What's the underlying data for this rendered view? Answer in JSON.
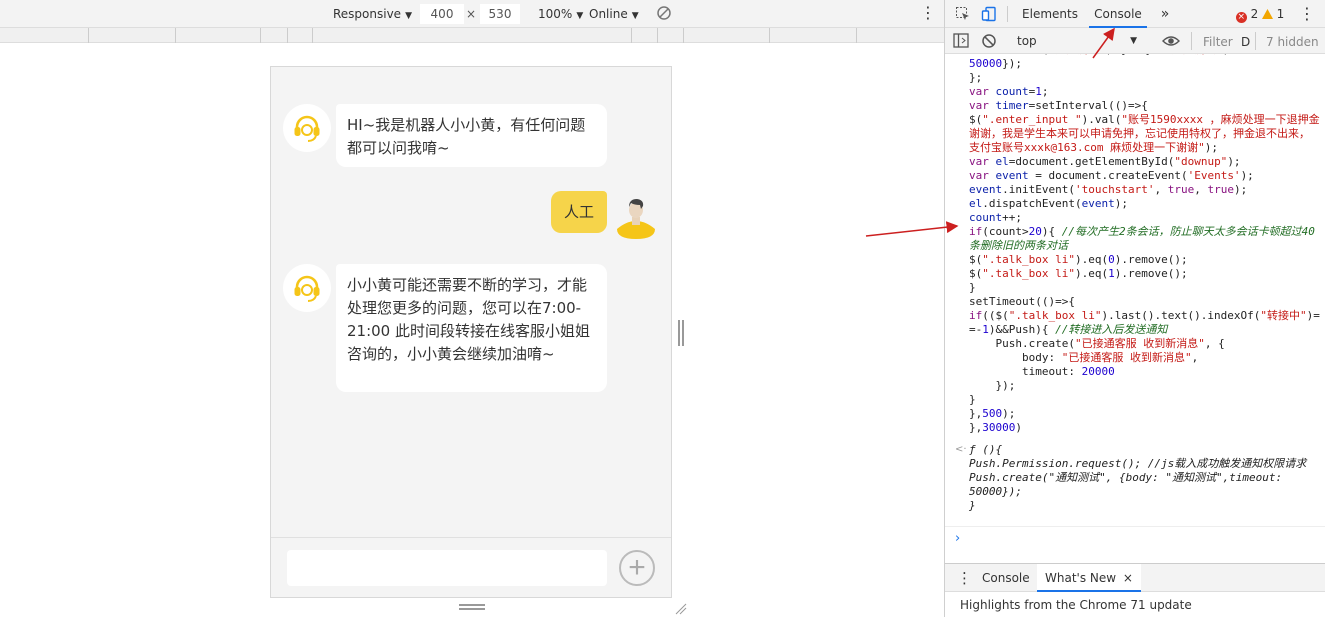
{
  "device_toolbar": {
    "device": "Responsive",
    "width": "400",
    "times": "×",
    "height": "530",
    "zoom": "100%",
    "throttle": "Online"
  },
  "chat": {
    "bot_message_1": "HI~我是机器人小小黄，有任何问题都可以问我唷~",
    "user_message": "人工",
    "bot_message_2": "小小黄可能还需要不断的学习，才能处理您更多的问题，您可以在7:00-21:00 此时间段转接在线客服小姐姐咨询的，小小黄会继续加油唷~",
    "add_glyph": "+"
  },
  "devtools": {
    "tabs": [
      "Elements",
      "Console"
    ],
    "more_tabs": "»",
    "error_count": "2",
    "warning_count": "1",
    "context": "top",
    "filter_placeholder": "Filter",
    "filter_level": "D",
    "hidden_count": "7 hidden",
    "drawer_tabs": [
      "Console",
      "What's New"
    ],
    "drawer_close": "×",
    "drawer_message": "Highlights from the Chrome 71 update",
    "result_marker": "<·"
  },
  "colors": {
    "bot_bubble": "#ffffff",
    "user_bubble": "#f6d44a",
    "headset_icon": "#f5c518",
    "devtools_accent": "#1a73e8",
    "annotation_arrow": "#cc1f1f",
    "error_badge": "#d93025",
    "warning_badge": "#f2a600"
  }
}
